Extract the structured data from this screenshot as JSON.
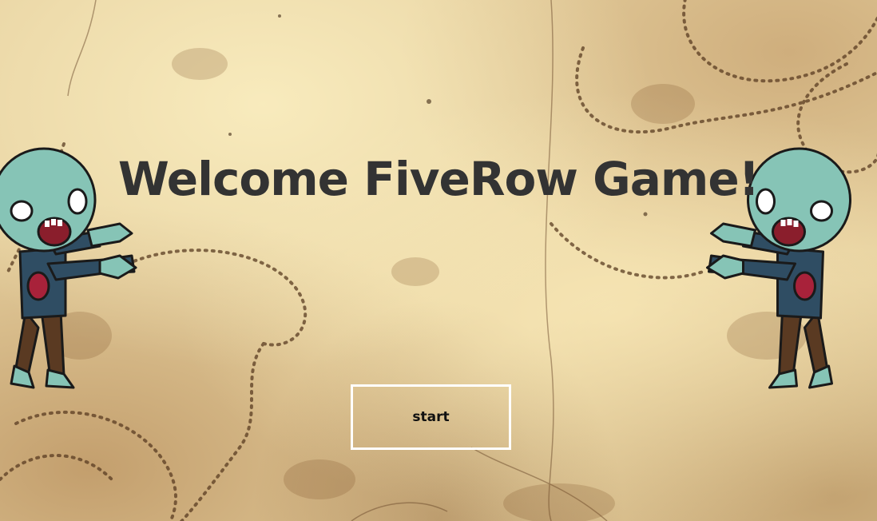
{
  "game": {
    "title": "Welcome FiveRow Game!",
    "start_label": "start"
  },
  "colors": {
    "background": "#e8d3a2",
    "title_text": "#333333",
    "button_border": "#ffffff",
    "zombie_skin": "#86c4b6",
    "zombie_shirt": "#2f4d63",
    "zombie_pants": "#5a3a22"
  },
  "icons": {
    "left_character": "zombie-left-icon",
    "right_character": "zombie-right-icon"
  }
}
